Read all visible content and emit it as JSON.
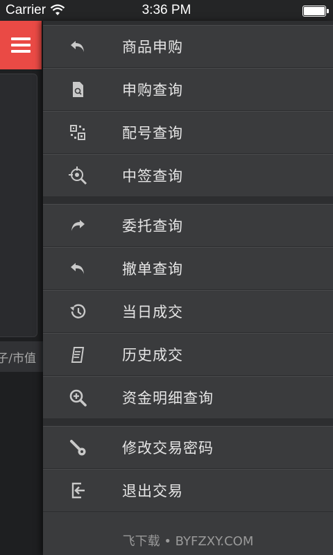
{
  "status_bar": {
    "carrier": "Carrier",
    "time": "3:36 PM"
  },
  "background": {
    "partial_label": "子/市值"
  },
  "menu_groups": [
    [
      {
        "label": "商品申购",
        "icon": "reply-arrow-icon"
      },
      {
        "label": "申购查询",
        "icon": "document-search-icon"
      },
      {
        "label": "配号查询",
        "icon": "qr-code-icon"
      },
      {
        "label": "中签查询",
        "icon": "target-search-icon"
      }
    ],
    [
      {
        "label": "委托查询",
        "icon": "forward-arrow-icon"
      },
      {
        "label": "撤单查询",
        "icon": "undo-arrow-icon"
      },
      {
        "label": "当日成交",
        "icon": "history-clock-icon"
      },
      {
        "label": "历史成交",
        "icon": "receipt-icon"
      },
      {
        "label": "资金明细查询",
        "icon": "zoom-in-icon"
      }
    ],
    [
      {
        "label": "修改交易密码",
        "icon": "key-icon"
      },
      {
        "label": "退出交易",
        "icon": "exit-icon"
      }
    ]
  ],
  "watermark": "飞下载 • BYFZXY.COM",
  "colors": {
    "accent": "#ea4a45",
    "drawer_bg": "#3a3b3d",
    "icon": "#c9c9c9"
  }
}
